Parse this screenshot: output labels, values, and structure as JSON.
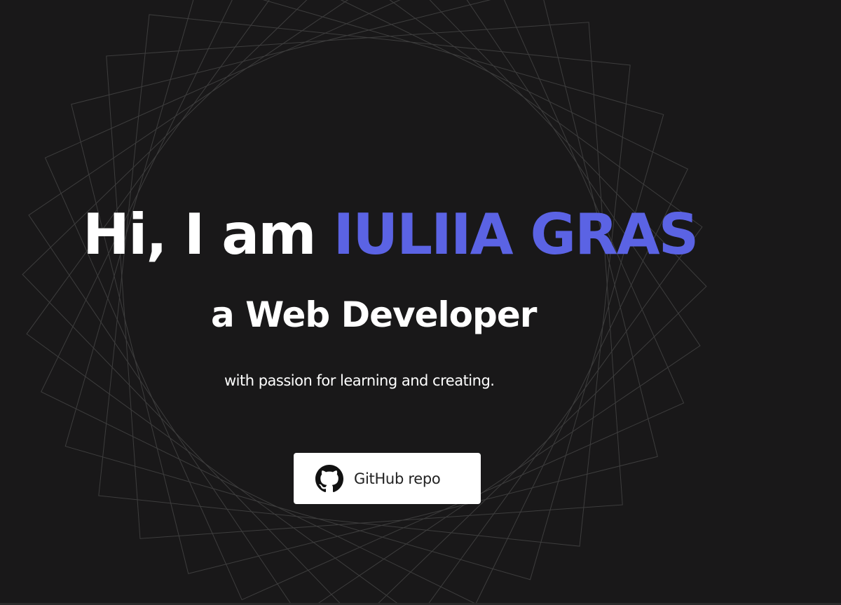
{
  "hero": {
    "greeting": "Hi, I am",
    "name": "IULIIA GRAS",
    "role": "a Web Developer",
    "tagline": "with passion for learning and creating."
  },
  "github_button": {
    "label": "GitHub repo",
    "icon": "github-icon"
  },
  "colors": {
    "background": "#191819",
    "accent": "#5b63e4",
    "text": "#ffffff",
    "button_bg": "#ffffff",
    "button_text": "#222222",
    "pattern_line": "#4a4a4a"
  }
}
